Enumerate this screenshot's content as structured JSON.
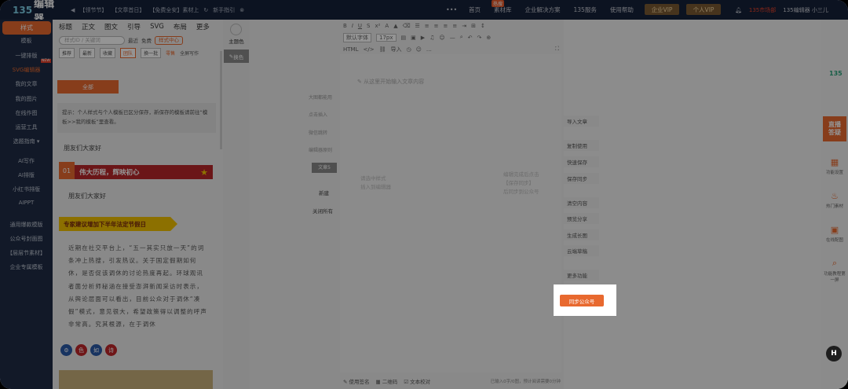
{
  "topbar": {
    "logo_num": "135",
    "logo_text": "编辑器",
    "notices": [
      "【领节节】",
      "【文章首日】",
      "【免费全安】素材上",
      "新手指引"
    ],
    "nav": [
      "首页",
      "素材库",
      "企业解决方案",
      "135服务",
      "使用帮助"
    ],
    "hot_badge": "热搜",
    "vip_enterprise": "企业VIP",
    "vip_personal": "个人VIP",
    "user_red": "135市场部",
    "user_name": "135编辑器 小三儿"
  },
  "sidebar": {
    "active": "样式",
    "items": [
      "模板",
      "一键排版",
      "SVG编辑器",
      "我的文章",
      "我的图片",
      "在线作图",
      "运营工具",
      "选题指南",
      "AI写作",
      "AI排版",
      "小红书排版",
      "AIPPT",
      "通用爆款模版",
      "公众号封面图",
      "【层层节素材】",
      "企业专属模板"
    ],
    "new_badge": "NEW"
  },
  "panel": {
    "tabs": [
      "标题",
      "正文",
      "图文",
      "引导",
      "SVG",
      "布局",
      "更多"
    ],
    "search_placeholder": "样式ID / 关键词",
    "search_options": [
      "最近",
      "免费"
    ],
    "style_center": "样式中心",
    "subtabs": [
      "推荐",
      "最新",
      "收藏",
      "团队",
      "换一批"
    ],
    "subtab_extra": [
      "零售",
      "全屏写作"
    ],
    "all_button": "全部",
    "tip": "提示：个人样式与个人模板已区分保存，新保存的模板请前往“模板>>我的模板”里查看。",
    "greeting_1": "朋友们大家好",
    "banner_num": "01",
    "banner_title": "伟大历程，辉映初心",
    "greeting_2": "朋友们大家好",
    "yellow_title": "专家建议增加下半年法定节假日",
    "article": "近期在社交平台上，“五一其实只放一天”的词条冲上热搜，引发热议。关于国定假期如何休，是否促该调休的讨论热度再起。环球观讯者菌分析师秘涵在接受澎湃新闻采访时表示，从舆论层面可以看出，目前公众对于调休“凑假”模式，意见很大，希望政策得以调整的呼声非常高。究其根源，在于调休",
    "circle_labels": [
      "色",
      "如",
      "诗"
    ]
  },
  "colcol": {
    "main_color": "主题色",
    "more": "换色"
  },
  "editor": {
    "toolbar_font": "默认字体",
    "toolbar_size": "17px",
    "toolbar_html": "HTML",
    "toolbar_import": "导入",
    "placeholder": "从这里开始输入文章内容",
    "side_items": [
      "大图都能用",
      "点击插入",
      "微信跳转",
      "编辑器原则",
      "文章5",
      "新建",
      "关闭所有"
    ],
    "faded_left": [
      "请选中样式",
      "插入到编辑器"
    ],
    "faded_right": [
      "编辑完成后点击",
      "【保存同步】",
      "后同步到公众号"
    ],
    "footer": [
      "使用签名",
      "二维码",
      "文本校对"
    ],
    "footer_right": "已输入0字/0图，预计阅读需要0分钟"
  },
  "actions": {
    "items": [
      "导入文章",
      "复制使用",
      "快速保存",
      "保存同步",
      "清空内容",
      "预览分享",
      "生成长图",
      "云端草稿",
      "更多功能"
    ],
    "sync_wechat": "同步公众号"
  },
  "right": {
    "brand": "135",
    "live": [
      "直播",
      "答疑"
    ],
    "tools": [
      "功能设置",
      "热门素材",
      "在线配图",
      "功能教程第一屏"
    ]
  },
  "colors": {
    "brand_orange": "#e8692f",
    "topbar_bg": "#16213a",
    "sidebar_bg": "#1f2c45",
    "banner_red": "#b8262a",
    "banner_yellow": "#f2c200"
  }
}
